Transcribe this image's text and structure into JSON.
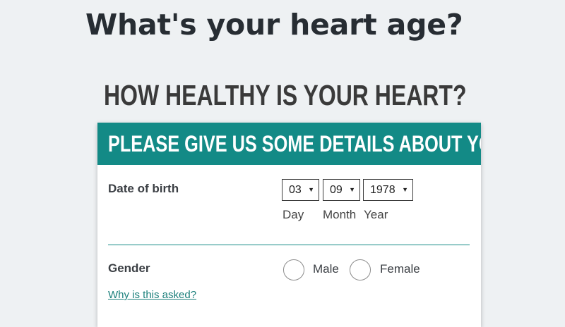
{
  "page": {
    "title": "What's your heart age?"
  },
  "section": {
    "heading": "HOW HEALTHY IS YOUR HEART?"
  },
  "form": {
    "header": "PLEASE GIVE US SOME DETAILS ABOUT YOU",
    "accent_color": "#138a86",
    "date_of_birth": {
      "label": "Date of birth",
      "day": {
        "value": "03",
        "label": "Day"
      },
      "month": {
        "value": "09",
        "label": "Month"
      },
      "year": {
        "value": "1978",
        "label": "Year"
      }
    },
    "gender": {
      "label": "Gender",
      "options": [
        {
          "label": "Male",
          "selected": false
        },
        {
          "label": "Female",
          "selected": false
        }
      ],
      "help_link": "Why is this asked?"
    }
  }
}
